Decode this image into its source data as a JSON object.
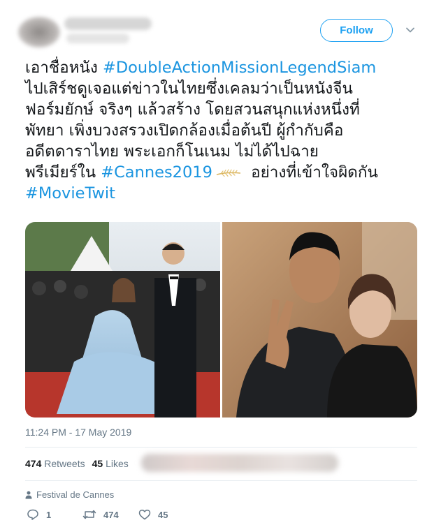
{
  "header": {
    "follow_label": "Follow"
  },
  "tweet": {
    "lines": [
      {
        "text": "เอาชื่อหนัง ",
        "hashtag": "#DoubleActionMissionLegendSiam"
      },
      {
        "text": "ไปเสิร์ชดูเจอแต่ข่าวในไทยซึ่งเคลมว่าเป็นหนังจีน"
      },
      {
        "text": "ฟอร์มยักษ์ จริงๆ แล้วสร้าง โดยสวนสนุกแห่งหนึ่งที่"
      },
      {
        "text": "พัทยา เพิ่งบวงสรวงเปิดกล้องเมื่อต้นปี ผู้กำกับคือ"
      },
      {
        "text": "อดีตดาราไทย พระเอกก็โนเนม ไม่ได้ไปฉาย"
      },
      {
        "text_before": "พรีเมียร์ใน ",
        "hashtag": "#Cannes2019",
        "text_after": " อย่างที่เข้าใจผิดกัน"
      },
      {
        "hashtag": "#MovieTwit"
      }
    ]
  },
  "timestamp": "11:24 PM - 17 May 2019",
  "stats": {
    "retweets_count": "474",
    "retweets_label": "Retweets",
    "likes_count": "45",
    "likes_label": "Likes"
  },
  "place": "Festival de Cannes",
  "actions": {
    "reply_count": "1",
    "retweet_count": "474",
    "like_count": "45"
  },
  "colors": {
    "accent": "#1da1f2",
    "hashtag": "#1b95e0",
    "secondary_text": "#657786"
  }
}
